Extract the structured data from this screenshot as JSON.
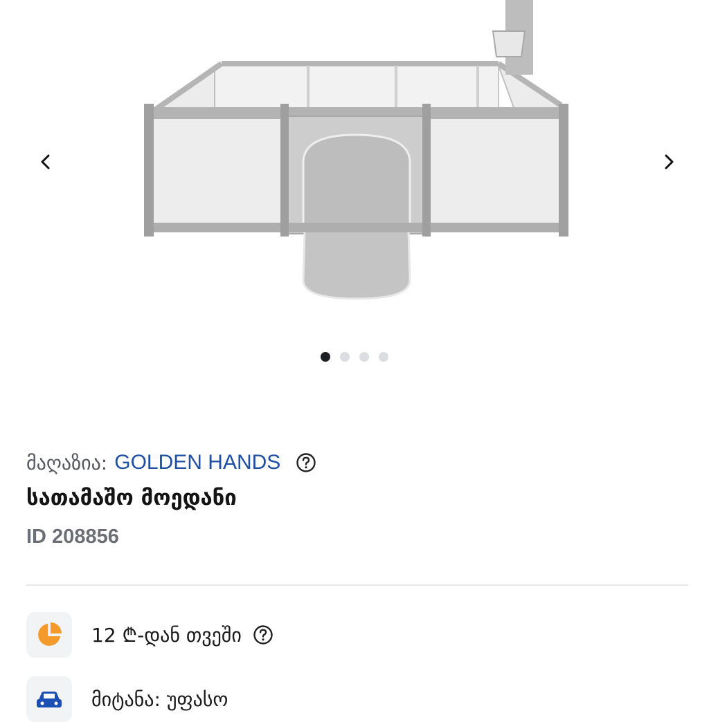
{
  "gallery": {
    "image_alt": "baby playpen with basketball hoop",
    "slide_count": 4,
    "active_slide": 1
  },
  "shop": {
    "label": "მაღაზია:",
    "name": "GOLDEN HANDS"
  },
  "product": {
    "title": "სათამაშო მოედანი",
    "id_text": "ID 208856"
  },
  "installment": {
    "text": "12 ₾-დან თვეში",
    "icon": "pie-chart-icon"
  },
  "delivery": {
    "text": "მიტანა: უფასო",
    "icon": "car-icon"
  },
  "colors": {
    "shop_link": "#1e4fa3",
    "installment_icon": "#f39a2b",
    "delivery_icon": "#1c4fb3",
    "active_dot": "#1c1f24"
  }
}
